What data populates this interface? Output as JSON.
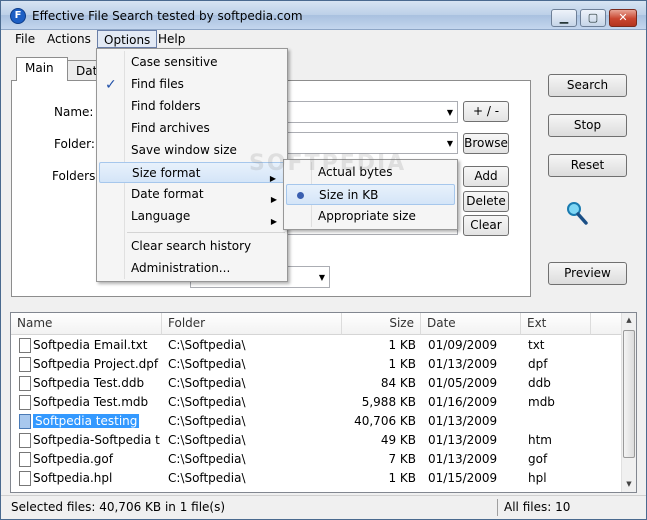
{
  "window": {
    "title": "Effective File Search tested by softpedia.com",
    "controls": {
      "minimize": "▁",
      "maximize": "▢",
      "close": "✕"
    }
  },
  "menubar": [
    "File",
    "Actions",
    "Options",
    "Help"
  ],
  "tabs": [
    "Main",
    "Date"
  ],
  "form": {
    "name_label": "Name:",
    "folder_label": "Folder:",
    "folders_label": "Folders:",
    "plus_minus": "+ / -",
    "browse": "Browse",
    "add": "Add",
    "delete": "Delete",
    "clear": "Clear"
  },
  "side_buttons": {
    "search": "Search",
    "stop": "Stop",
    "reset": "Reset",
    "preview": "Preview"
  },
  "options_menu": {
    "items": [
      {
        "label": "Case sensitive",
        "checked": false
      },
      {
        "label": "Find files",
        "checked": true
      },
      {
        "label": "Find folders",
        "checked": false
      },
      {
        "label": "Find archives",
        "checked": false
      },
      {
        "label": "Save window size",
        "checked": false
      },
      {
        "label": "Size format",
        "submenu": true,
        "highlighted": true
      },
      {
        "label": "Date format",
        "submenu": true
      },
      {
        "label": "Language",
        "submenu": true
      },
      {
        "label": "Clear search history"
      },
      {
        "label": "Administration..."
      }
    ]
  },
  "size_format_submenu": [
    {
      "label": "Actual bytes",
      "selected": false
    },
    {
      "label": "Size in KB",
      "selected": true
    },
    {
      "label": "Appropriate size",
      "selected": false
    }
  ],
  "watermark": "SOFTPEDIA",
  "list": {
    "columns": [
      "Name",
      "Folder",
      "Size",
      "Date",
      "Ext"
    ],
    "rows": [
      {
        "name": "Softpedia Email.txt",
        "folder": "C:\\Softpedia\\",
        "size": "1 KB",
        "date": "01/09/2009",
        "ext": "txt",
        "selected": false
      },
      {
        "name": "Softpedia Project.dpf",
        "folder": "C:\\Softpedia\\",
        "size": "1 KB",
        "date": "01/13/2009",
        "ext": "dpf",
        "selected": false
      },
      {
        "name": "Softpedia Test.ddb",
        "folder": "C:\\Softpedia\\",
        "size": "84 KB",
        "date": "01/05/2009",
        "ext": "ddb",
        "selected": false
      },
      {
        "name": "Softpedia Test.mdb",
        "folder": "C:\\Softpedia\\",
        "size": "5,988 KB",
        "date": "01/16/2009",
        "ext": "mdb",
        "selected": false
      },
      {
        "name": "Softpedia testing",
        "folder": "C:\\Softpedia\\",
        "size": "40,706 KB",
        "date": "01/13/2009",
        "ext": "",
        "selected": true
      },
      {
        "name": "Softpedia-Softpedia t...",
        "folder": "C:\\Softpedia\\",
        "size": "49 KB",
        "date": "01/13/2009",
        "ext": "htm",
        "selected": false
      },
      {
        "name": "Softpedia.gof",
        "folder": "C:\\Softpedia\\",
        "size": "7 KB",
        "date": "01/13/2009",
        "ext": "gof",
        "selected": false
      },
      {
        "name": "Softpedia.hpl",
        "folder": "C:\\Softpedia\\",
        "size": "1 KB",
        "date": "01/15/2009",
        "ext": "hpl",
        "selected": false
      }
    ]
  },
  "status": {
    "left": "Selected files: 40,706 KB in 1 file(s)",
    "right": "All files: 10"
  }
}
